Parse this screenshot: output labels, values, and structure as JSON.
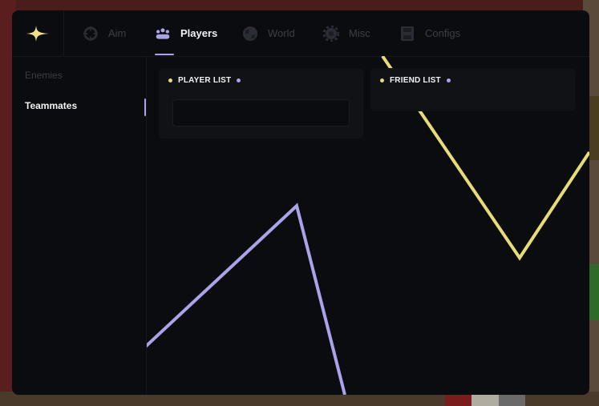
{
  "tabs": [
    {
      "label": "Aim",
      "icon": "crosshair-icon"
    },
    {
      "label": "Players",
      "icon": "players-icon"
    },
    {
      "label": "World",
      "icon": "globe-icon"
    },
    {
      "label": "Misc",
      "icon": "gear-icon"
    },
    {
      "label": "Configs",
      "icon": "save-icon"
    }
  ],
  "active_tab": "Players",
  "sidebar": {
    "items": [
      {
        "label": "Enemies"
      },
      {
        "label": "Teammates"
      }
    ],
    "active": "Teammates"
  },
  "panels": {
    "player_list": {
      "title": "PLAYER LIST"
    },
    "friend_list": {
      "title": "FRIEND LIST"
    }
  },
  "colors": {
    "accent_purple": "#a9a4e8",
    "accent_yellow": "#e6dc78",
    "window_bg": "#0b0c0f",
    "panel_bg": "#101216"
  }
}
